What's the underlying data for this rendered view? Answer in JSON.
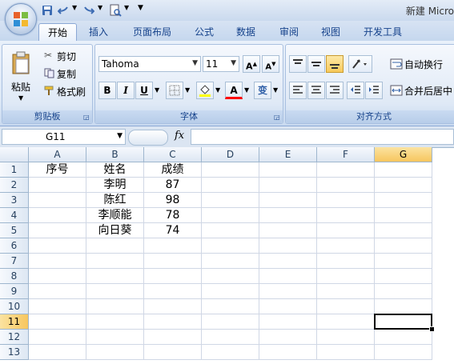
{
  "window": {
    "title": "新建 Micro"
  },
  "ribbon_tabs": [
    "开始",
    "插入",
    "页面布局",
    "公式",
    "数据",
    "审阅",
    "视图",
    "开发工具"
  ],
  "clipboard": {
    "paste": "粘贴",
    "cut": "剪切",
    "copy": "复制",
    "format_painter": "格式刷",
    "group_label": "剪贴板"
  },
  "font": {
    "name": "Tahoma",
    "size": "11",
    "group_label": "字体",
    "bold": "B",
    "italic": "I",
    "underline": "U",
    "font_color_glyph": "A",
    "phonetic_glyph": "变"
  },
  "alignment": {
    "wrap_text": "自动换行",
    "merge_center": "合并后居中",
    "group_label": "对齐方式"
  },
  "formula_bar": {
    "name_box": "G11",
    "fx": "fx",
    "formula": ""
  },
  "sheet": {
    "columns": [
      "A",
      "B",
      "C",
      "D",
      "E",
      "F",
      "G"
    ],
    "rows": [
      "1",
      "2",
      "3",
      "4",
      "5",
      "6",
      "7",
      "8",
      "9",
      "10",
      "11",
      "12",
      "13"
    ],
    "selected_column": "G",
    "selected_row": "11",
    "cells": {
      "A1": "序号",
      "B1": "姓名",
      "C1": "成绩",
      "B2": "李明",
      "C2": "87",
      "B3": "陈红",
      "C3": "98",
      "B4": "李顺能",
      "C4": "78",
      "B5": "向日葵",
      "C5": "74"
    }
  },
  "colors": {
    "accent": "#15428b",
    "selected_header": "#f7c65e",
    "gridline": "#d0d7e5"
  }
}
